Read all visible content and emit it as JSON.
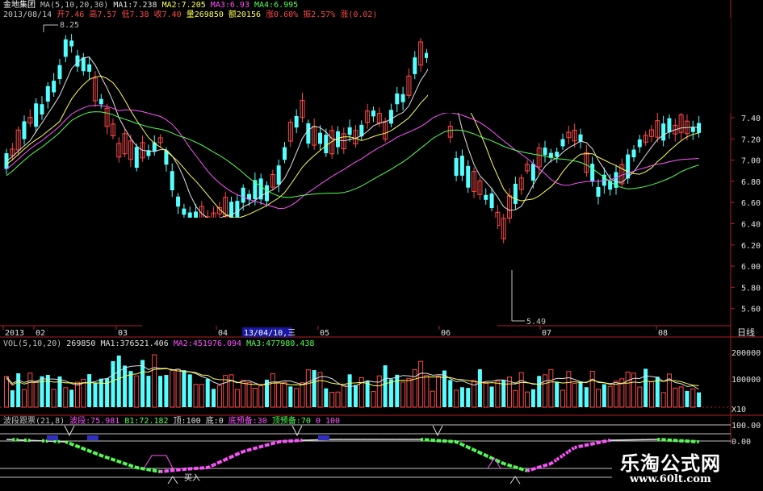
{
  "stock": {
    "name": "金地集团",
    "date": "2013/08/14",
    "period": "日线"
  },
  "ma_header": {
    "label": "MA(5,10,20,30)",
    "ma1": "MA1:7.238",
    "ma2": "MA2:7.205",
    "ma3": "MA3:6.93",
    "ma4": "MA4:6.995"
  },
  "quote": {
    "open": "开7.46",
    "high": "高7.57",
    "low": "低7.38",
    "close": "收7.40",
    "volume": "量269850",
    "amount": "额20156",
    "change_pct": "涨0.60%",
    "amplitude": "振2.57%",
    "change": "涨(0.02)"
  },
  "annotations": {
    "high_mark": "8.25",
    "low_mark": "5.49",
    "buy_label": "买入"
  },
  "price_axis": [
    "7.40",
    "7.20",
    "7.00",
    "6.80",
    "6.60",
    "6.40",
    "6.20",
    "6.00",
    "5.80",
    "5.60"
  ],
  "time_axis": [
    "2013",
    "02",
    "03",
    "04",
    "05",
    "06",
    "07",
    "08"
  ],
  "cursor_date": "13/04/10,三",
  "vol_header": {
    "label": "VOL(5,10,20)",
    "value": "269850",
    "ma1": "MA1:376521.406",
    "ma2": "MA2:451976.094",
    "ma3": "MA3:477980.438"
  },
  "vol_axis": [
    "200000",
    "100000",
    "X10"
  ],
  "indicator_header": {
    "label": "波段跟票(21,8)",
    "bd": "波段:75.981",
    "b1": "B1:72.182",
    "top": "顶:100",
    "bottom": "底:0",
    "bottom_warn": "底预备:30",
    "top_warn": "顶预备:70",
    "v1": "0",
    "v2": "100"
  },
  "ind_axis": [
    "100.00",
    "0.00"
  ],
  "watermark": {
    "title": "乐淘公式网",
    "url": "www.60lt.com"
  },
  "colors": {
    "up": "#ff4a4a",
    "down": "#54ffff",
    "ma1": "#e0e0e0",
    "ma2": "#ffff54",
    "ma3": "#ff54ff",
    "ma4": "#54ff54",
    "axis": "#b02020"
  }
}
